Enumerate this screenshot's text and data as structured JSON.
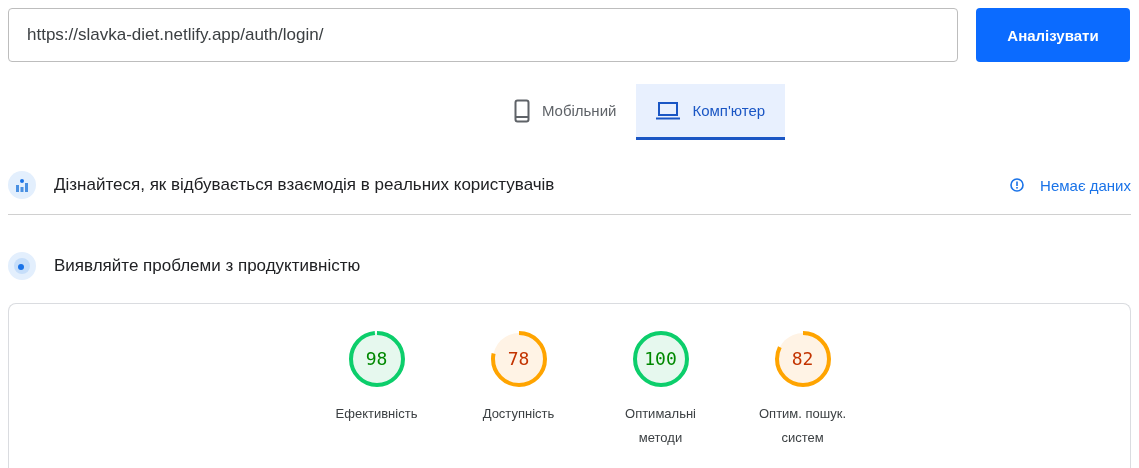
{
  "url_field": {
    "value": "https://slavka-diet.netlify.app/auth/login/"
  },
  "analyze_button": {
    "label": "Аналізувати"
  },
  "tabs": [
    {
      "label": "Мобільний",
      "kind": "phone",
      "selected": false
    },
    {
      "label": "Комп'ютер",
      "kind": "laptop",
      "selected": true
    }
  ],
  "field_data": {
    "title": "Дізнайтеся, як відбувається взаємодія в реальних користувачів",
    "status": "Немає даних"
  },
  "lab_data": {
    "title": "Виявляйте проблеми з продуктивністю"
  },
  "scores": [
    {
      "value": "98",
      "label": "Ефективність"
    },
    {
      "value": "78",
      "label": "Доступність"
    },
    {
      "value": "100",
      "label": "Оптимальні методи"
    },
    {
      "value": "82",
      "label": "Оптим. пошук. систем"
    }
  ]
}
